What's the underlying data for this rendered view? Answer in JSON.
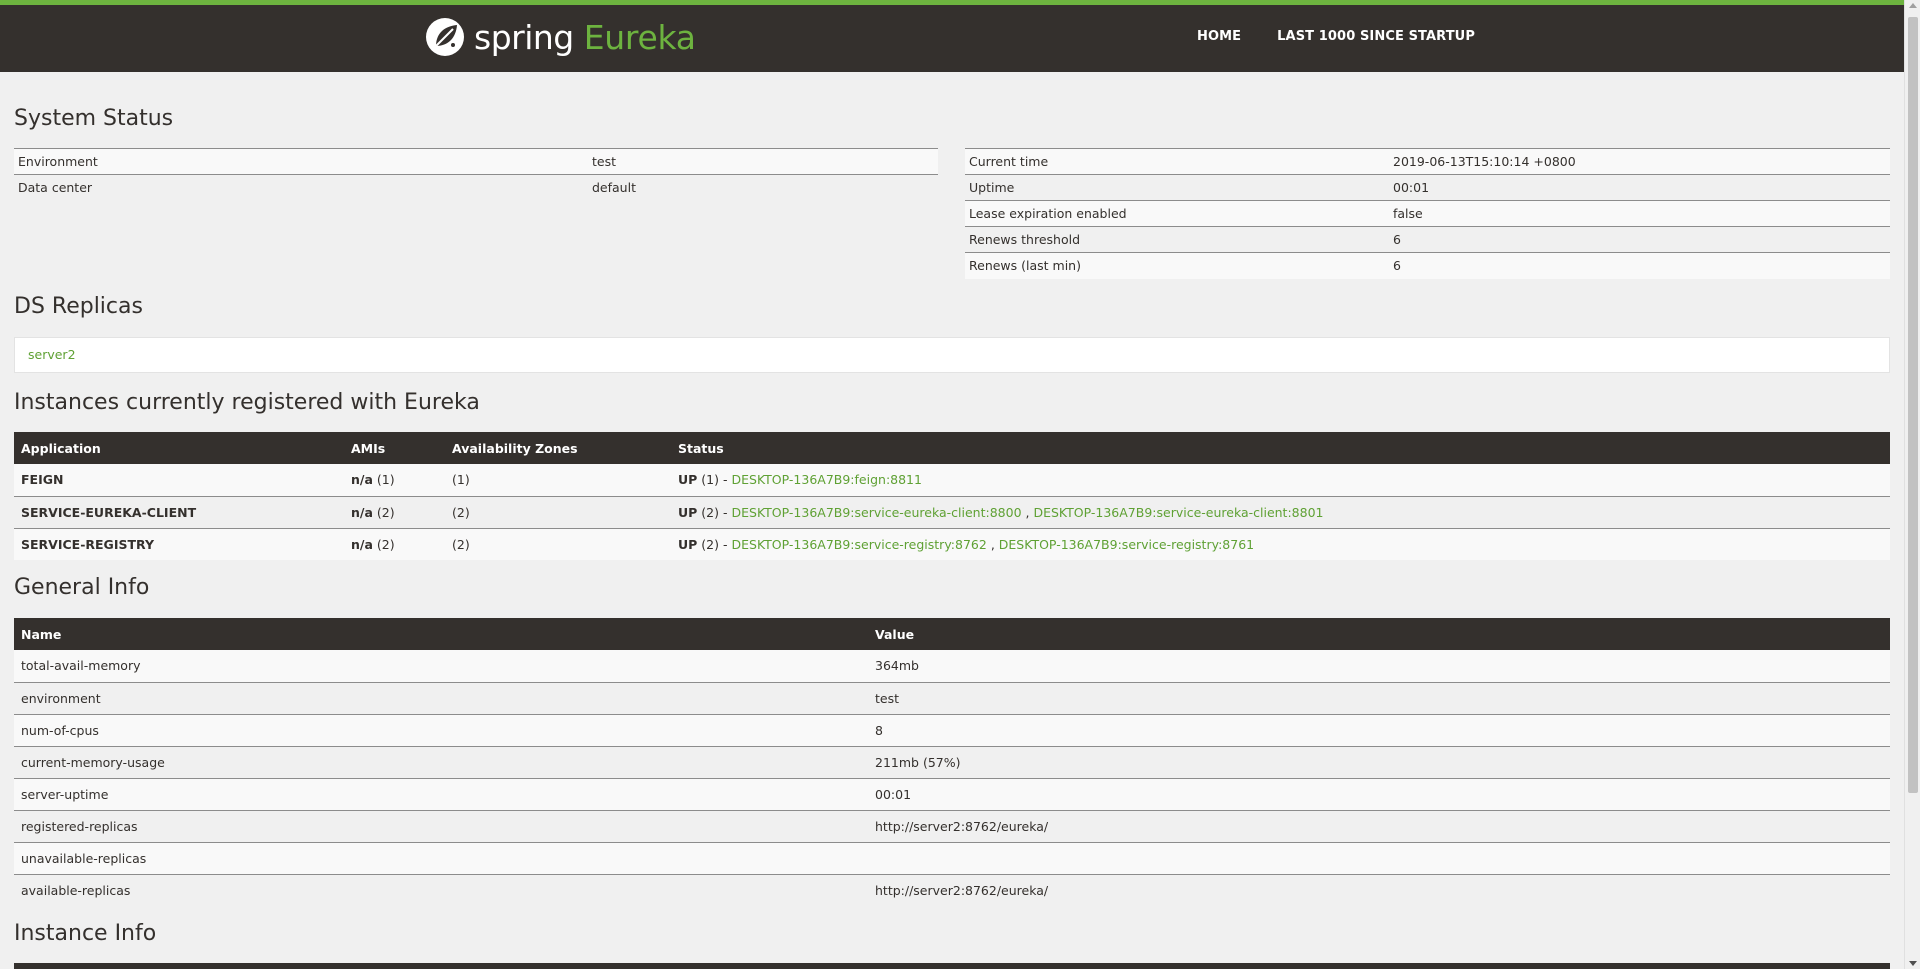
{
  "nav": {
    "brand_spring": "spring",
    "brand_eureka": "Eureka",
    "links": [
      "HOME",
      "LAST 1000 SINCE STARTUP"
    ]
  },
  "system_status": {
    "title": "System Status",
    "left": [
      {
        "label": "Environment",
        "value": "test"
      },
      {
        "label": "Data center",
        "value": "default"
      }
    ],
    "right": [
      {
        "label": "Current time",
        "value": "2019-06-13T15:10:14 +0800"
      },
      {
        "label": "Uptime",
        "value": "00:01"
      },
      {
        "label": "Lease expiration enabled",
        "value": "false"
      },
      {
        "label": "Renews threshold",
        "value": "6"
      },
      {
        "label": "Renews (last min)",
        "value": "6"
      }
    ]
  },
  "ds_replicas": {
    "title": "DS Replicas",
    "items": [
      "server2"
    ]
  },
  "instances": {
    "title": "Instances currently registered with Eureka",
    "headers": [
      "Application",
      "AMIs",
      "Availability Zones",
      "Status"
    ],
    "rows": [
      {
        "application": "FEIGN",
        "amis_na": "n/a",
        "amis_count": "(1)",
        "zones": "(1)",
        "status_prefix": "UP",
        "status_count": "(1) -",
        "links": [
          "DESKTOP-136A7B9:feign:8811"
        ]
      },
      {
        "application": "SERVICE-EUREKA-CLIENT",
        "amis_na": "n/a",
        "amis_count": "(2)",
        "zones": "(2)",
        "status_prefix": "UP",
        "status_count": "(2) -",
        "links": [
          "DESKTOP-136A7B9:service-eureka-client:8800",
          "DESKTOP-136A7B9:service-eureka-client:8801"
        ]
      },
      {
        "application": "SERVICE-REGISTRY",
        "amis_na": "n/a",
        "amis_count": "(2)",
        "zones": "(2)",
        "status_prefix": "UP",
        "status_count": "(2) -",
        "links": [
          "DESKTOP-136A7B9:service-registry:8762",
          "DESKTOP-136A7B9:service-registry:8761"
        ]
      }
    ]
  },
  "general_info": {
    "title": "General Info",
    "headers": [
      "Name",
      "Value"
    ],
    "rows": [
      {
        "name": "total-avail-memory",
        "value": "364mb"
      },
      {
        "name": "environment",
        "value": "test"
      },
      {
        "name": "num-of-cpus",
        "value": "8"
      },
      {
        "name": "current-memory-usage",
        "value": "211mb (57%)"
      },
      {
        "name": "server-uptime",
        "value": "00:01"
      },
      {
        "name": "registered-replicas",
        "value": "http://server2:8762/eureka/"
      },
      {
        "name": "unavailable-replicas",
        "value": ""
      },
      {
        "name": "available-replicas",
        "value": "http://server2:8762/eureka/"
      }
    ]
  },
  "instance_info": {
    "title": "Instance Info"
  },
  "colors": {
    "brand_green": "#6db33f",
    "link_green": "#5fa134",
    "dark": "#34302d"
  }
}
